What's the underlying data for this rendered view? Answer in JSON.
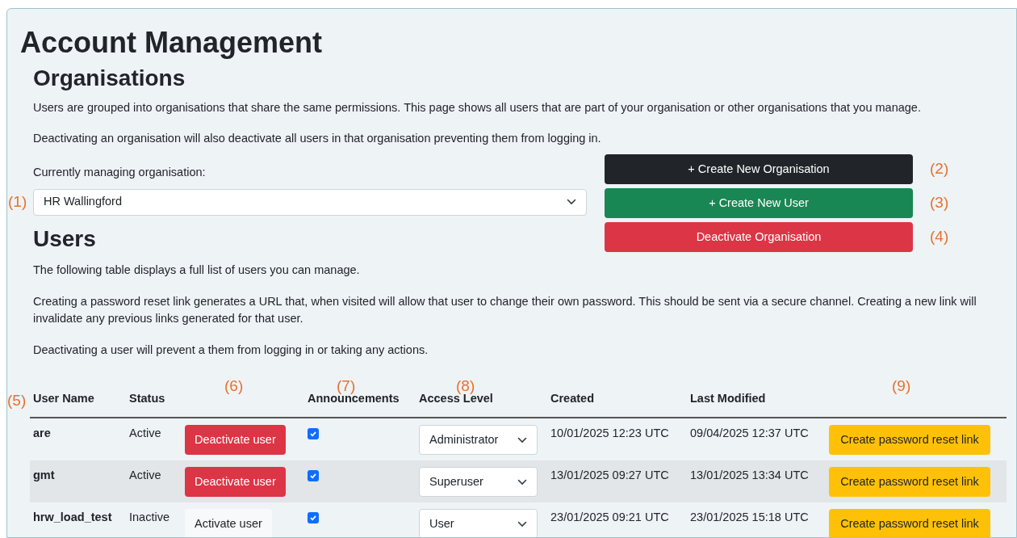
{
  "title": "Account Management",
  "organisations": {
    "heading": "Organisations",
    "paragraphs": [
      "Users are grouped into organisations that share the same permissions. This page shows all users that are part of your organisation or other organisations that you manage.",
      "Deactivating an organisation will also deactivate all users in that organisation preventing them from logging in."
    ],
    "select_label": "Currently managing organisation:",
    "select": {
      "value": "HR Wallingford",
      "annotation": "(1)"
    },
    "buttons": [
      {
        "label": "+ Create New Organisation",
        "kind": "dark",
        "annotation": "(2)"
      },
      {
        "label": "+ Create New User",
        "kind": "success",
        "annotation": "(3)"
      },
      {
        "label": "Deactivate Organisation",
        "kind": "danger",
        "annotation": "(4)"
      }
    ]
  },
  "users": {
    "heading": "Users",
    "paragraphs": [
      "The following table displays a full list of users you can manage.",
      "Creating a password reset link generates a URL that, when visited will allow that user to change their own password. This should be sent via a secure channel. Creating a new link will invalidate any previous links generated for that user.",
      "Deactivating a user will prevent a them from logging in or taking any actions."
    ],
    "table": {
      "columns": [
        {
          "label": "User Name",
          "annotation": "(5)"
        },
        {
          "label": "Status"
        },
        {
          "annotation": "(6)"
        },
        {
          "label": "Announcements",
          "annotation": "(7)"
        },
        {
          "label": "Access Level",
          "annotation": "(8)"
        },
        {
          "label": "Created"
        },
        {
          "label": "Last Modified"
        },
        {
          "annotation": "(9)"
        }
      ],
      "rows": [
        {
          "name": "are",
          "status": "Active",
          "action": {
            "label": "Deactivate user",
            "kind": "danger"
          },
          "announcements": true,
          "access_level": "Administrator",
          "created": "10/01/2025 12:23 UTC",
          "modified": "09/04/2025 12:37 UTC",
          "reset": "Create password reset link"
        },
        {
          "name": "gmt",
          "status": "Active",
          "action": {
            "label": "Deactivate user",
            "kind": "danger"
          },
          "announcements": true,
          "access_level": "Superuser",
          "created": "13/01/2025 09:27 UTC",
          "modified": "13/01/2025 13:34 UTC",
          "reset": "Create password reset link"
        },
        {
          "name": "hrw_load_test",
          "status": "Inactive",
          "action": {
            "label": "Activate user",
            "kind": "light"
          },
          "announcements": true,
          "access_level": "User",
          "created": "23/01/2025 09:21 UTC",
          "modified": "23/01/2025 15:18 UTC",
          "reset": "Create password reset link"
        }
      ]
    }
  }
}
